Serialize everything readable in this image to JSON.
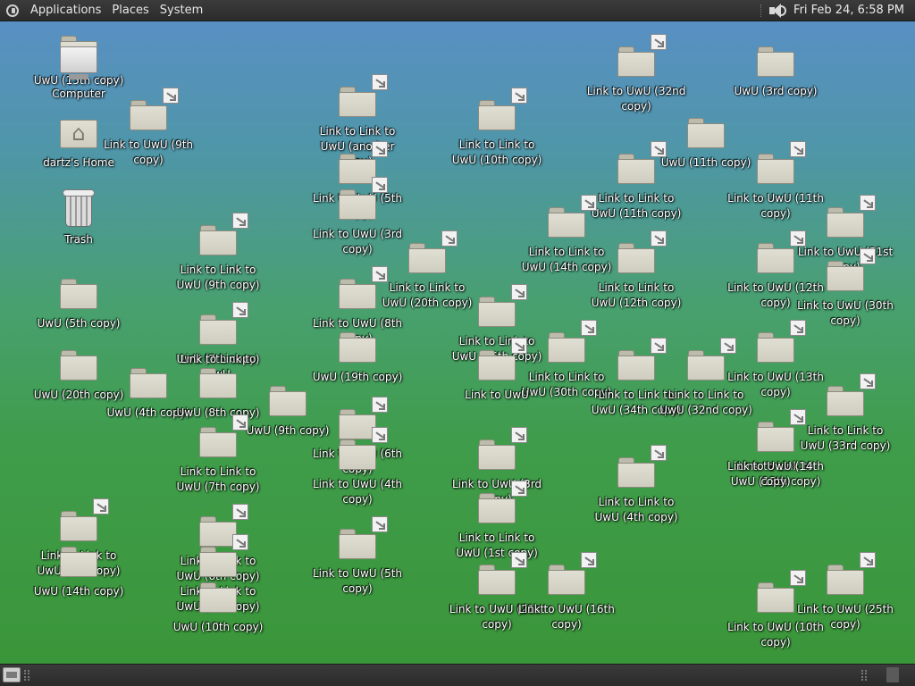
{
  "top_panel": {
    "menus": [
      "Applications",
      "Places",
      "System"
    ],
    "icons": [
      "distro-logo-icon",
      "volume-icon"
    ],
    "clock": "Fri Feb 24,  6:58 PM"
  },
  "bottom_panel": {
    "icons": [
      "show-desktop-icon",
      "trash-applet-icon"
    ]
  },
  "desktop": {
    "icons": [
      {
        "label": "UwU (15th copy)",
        "type": "folder",
        "link": false
      },
      {
        "label": "Computer",
        "type": "computer",
        "link": false
      },
      {
        "label": "Link to UwU (9th copy)",
        "type": "folder",
        "link": true
      },
      {
        "label": "Link to Link to UwU (another copy)",
        "type": "folder",
        "link": true
      },
      {
        "label": "Link to Link to UwU (10th copy)",
        "type": "folder",
        "link": true
      },
      {
        "label": "Link to UwU (32nd copy)",
        "type": "folder",
        "link": true
      },
      {
        "label": "UwU (3rd copy)",
        "type": "folder",
        "link": false
      },
      {
        "label": "dartz's Home",
        "type": "home",
        "link": false
      },
      {
        "label": "UwU (11th copy)",
        "type": "folder",
        "link": false
      },
      {
        "label": "Link to Link to UwU (11th copy)",
        "type": "folder",
        "link": true
      },
      {
        "label": "Link to UwU (11th copy)",
        "type": "folder",
        "link": true
      },
      {
        "label": "Trash",
        "type": "trash",
        "link": false
      },
      {
        "label": "Link to UwU (5th copy)",
        "type": "folder",
        "link": true
      },
      {
        "label": "Link to UwU (3rd copy)",
        "type": "folder",
        "link": true
      },
      {
        "label": "Link to Link to UwU (9th copy)",
        "type": "folder",
        "link": true
      },
      {
        "label": "Link to Link to UwU (14th copy)",
        "type": "folder",
        "link": true
      },
      {
        "label": "Link to UwU (31st copy)",
        "type": "folder",
        "link": true
      },
      {
        "label": "Link to Link to UwU (20th copy)",
        "type": "folder",
        "link": true
      },
      {
        "label": "Link to Link to UwU (12th copy)",
        "type": "folder",
        "link": true
      },
      {
        "label": "Link to UwU (12th copy)",
        "type": "folder",
        "link": true
      },
      {
        "label": "Link to UwU (30th copy)",
        "type": "folder",
        "link": true
      },
      {
        "label": "UwU (5th copy)",
        "type": "folder",
        "link": false
      },
      {
        "label": "Link to UwU (8th copy)",
        "type": "folder",
        "link": true
      },
      {
        "label": "UwU (7th copy)",
        "type": "folder",
        "link": false
      },
      {
        "label": "Link to Link to UwU (25th copy)",
        "type": "folder",
        "link": true
      },
      {
        "label": "Link to Link to UwU (30th copy)",
        "type": "folder",
        "link": true
      },
      {
        "label": "Link to Link to UwU (34th copy)",
        "type": "folder",
        "link": true
      },
      {
        "label": "Link to Link to UwU (32nd copy)",
        "type": "folder",
        "link": true
      },
      {
        "label": "Link to UwU (13th copy)",
        "type": "folder",
        "link": true
      },
      {
        "label": "UwU (20th copy)",
        "type": "folder",
        "link": false
      },
      {
        "label": "UwU (4th copy)",
        "type": "folder",
        "link": false
      },
      {
        "label": "Link to Link to UwU",
        "type": "folder",
        "link": true
      },
      {
        "label": "UwU (8th copy)",
        "type": "folder",
        "link": false
      },
      {
        "label": "UwU (9th copy)",
        "type": "folder",
        "link": false
      },
      {
        "label": "UwU (19th copy)",
        "type": "folder",
        "link": false
      },
      {
        "label": "Link to UwU",
        "type": "folder",
        "link": true
      },
      {
        "label": "Link to Link to UwU (33rd copy)",
        "type": "folder",
        "link": true
      },
      {
        "label": "Link to Link to UwU (7th copy)",
        "type": "folder",
        "link": true
      },
      {
        "label": "Link to UwU (6th copy)",
        "type": "folder",
        "link": true
      },
      {
        "label": "Link to UwU (4th copy)",
        "type": "folder",
        "link": true
      },
      {
        "label": "Link to UwU (3rd copy)",
        "type": "folder",
        "link": true
      },
      {
        "label": "Link to Link to UwU (13th copy)",
        "type": "folder",
        "link": true
      },
      {
        "label": "Link to UwU (14th copy)",
        "type": "folder",
        "link": true
      },
      {
        "label": "Link to Link to UwU (4th copy)",
        "type": "folder",
        "link": true
      },
      {
        "label": "Link to Link to UwU (8th copy)",
        "type": "folder",
        "link": true
      },
      {
        "label": "Link to Link to UwU (6th copy)",
        "type": "folder",
        "link": true
      },
      {
        "label": "Link to UwU (5th copy)",
        "type": "folder",
        "link": true
      },
      {
        "label": "Link to Link to UwU (1st copy)",
        "type": "folder",
        "link": true
      },
      {
        "label": "UwU (14th copy)",
        "type": "folder",
        "link": false
      },
      {
        "label": "Link to Link to UwU (5th copy)",
        "type": "folder",
        "link": true
      },
      {
        "label": "UwU (10th copy)",
        "type": "folder",
        "link": false
      },
      {
        "label": "Link to UwU (21st copy)",
        "type": "folder",
        "link": true
      },
      {
        "label": "Link to UwU (16th copy)",
        "type": "folder",
        "link": true
      },
      {
        "label": "Link to UwU (10th copy)",
        "type": "folder",
        "link": true
      },
      {
        "label": "Link to UwU (25th copy)",
        "type": "folder",
        "link": true
      }
    ]
  }
}
